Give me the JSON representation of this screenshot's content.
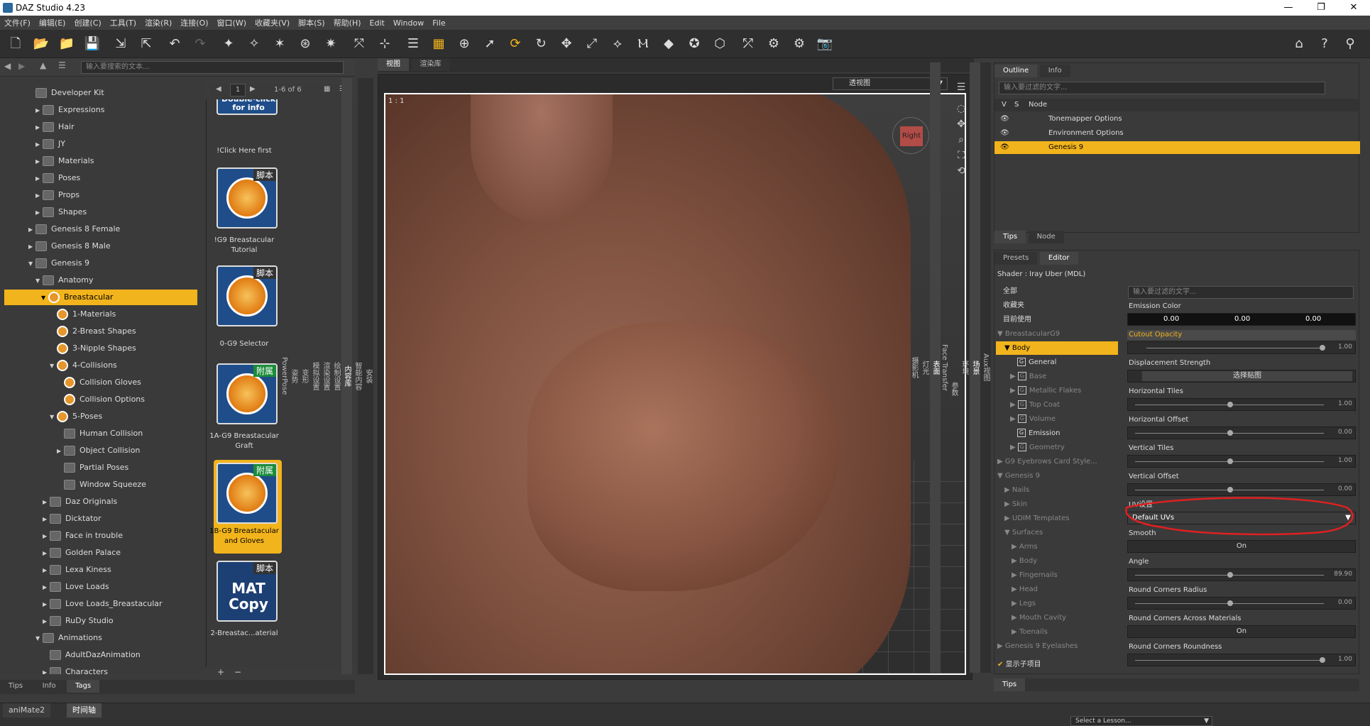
{
  "window": {
    "title": "DAZ Studio 4.23"
  },
  "menu": [
    "文件(F)",
    "编辑(E)",
    "创建(C)",
    "工具(T)",
    "渲染(R)",
    "连接(O)",
    "窗口(W)",
    "收藏夹(V)",
    "脚本(S)",
    "帮助(H)",
    "Edit",
    "Window",
    "File"
  ],
  "library": {
    "search_placeholder": "输入要搜索的文本...",
    "items": [
      {
        "label": "Developer Kit"
      },
      {
        "label": "Expressions"
      },
      {
        "label": "Hair"
      },
      {
        "label": "JY"
      },
      {
        "label": "Materials"
      },
      {
        "label": "Poses"
      },
      {
        "label": "Props"
      },
      {
        "label": "Shapes"
      },
      {
        "label": "Genesis 8 Female"
      },
      {
        "label": "Genesis 8 Male"
      },
      {
        "label": "Genesis 9"
      },
      {
        "label": "Anatomy"
      },
      {
        "label": "Breastacular"
      },
      {
        "label": "1-Materials"
      },
      {
        "label": "2-Breast Shapes"
      },
      {
        "label": "3-Nipple Shapes"
      },
      {
        "label": "4-Collisions"
      },
      {
        "label": "Collision Gloves"
      },
      {
        "label": "Collision Options"
      },
      {
        "label": "5-Poses"
      },
      {
        "label": "Human Collision"
      },
      {
        "label": "Object Collision"
      },
      {
        "label": "Partial Poses"
      },
      {
        "label": "Window Squeeze"
      },
      {
        "label": "Daz Originals"
      },
      {
        "label": "Dicktator"
      },
      {
        "label": "Face in trouble"
      },
      {
        "label": "Golden Palace"
      },
      {
        "label": "Lexa Kiness"
      },
      {
        "label": "Love Loads"
      },
      {
        "label": "Love Loads_Breastacular"
      },
      {
        "label": "RuDy Studio"
      },
      {
        "label": "Animations"
      },
      {
        "label": "AdultDazAnimation"
      },
      {
        "label": "Characters"
      }
    ],
    "bottom_tabs": [
      "Tips",
      "Info",
      "Tags"
    ]
  },
  "thumbs": {
    "page": "1",
    "count": "1-6 of 6",
    "items": [
      {
        "caption": "!Click Here first",
        "badge": "",
        "top_text": "Double-click for info"
      },
      {
        "caption": "!G9 Breastacular Tutorial",
        "badge": "脚本"
      },
      {
        "caption": "0-G9 Selector",
        "badge": "脚本"
      },
      {
        "caption": "1A-G9 Breastacular Graft",
        "badge": "附属"
      },
      {
        "caption": "1B-G9 Breastacular and Gloves",
        "badge": "附属"
      },
      {
        "caption": "2-Breastac...aterial",
        "badge": "脚本",
        "mat": "MAT Copy"
      }
    ]
  },
  "side_tabs_left": [
    "安装",
    "智能内容",
    "内容库",
    "绘制设置",
    "渲染设置",
    "模拟设置",
    "变形",
    "姿势",
    "PowerPose"
  ],
  "viewport": {
    "tabs": [
      "视图",
      "渲染库"
    ],
    "camera": "透视图",
    "ratio": "1 : 1",
    "cube_label": "Right"
  },
  "outline": {
    "tabs": [
      "Outline",
      "Info"
    ],
    "filter_placeholder": "输入要过滤的文字...",
    "cols": [
      "V",
      "S",
      "Node"
    ],
    "rows": [
      "Tonemapper Options",
      "Environment Options",
      "Genesis 9"
    ],
    "bottom_tabs": [
      "Tips",
      "Node"
    ]
  },
  "side_tabs_right": [
    "Aux视图",
    "场景",
    "环境",
    "参数",
    "Face Transfer",
    "表面",
    "灯光",
    "摄影机"
  ],
  "editor": {
    "tabs": [
      "Presets",
      "Editor"
    ],
    "shader": "Shader : Iray Uber (MDL)",
    "filter_placeholder": "输入要过滤的文字...",
    "list": [
      "全部",
      "收藏夹",
      "目前使用",
      "BreastacularG9",
      "Body",
      "General",
      "Base",
      "Metallic Flakes",
      "Top Coat",
      "Volume",
      "Emission",
      "Geometry",
      "G9 Eyebrows Card Style...",
      "Genesis 9",
      "Nails",
      "Skin",
      "UDIM Templates",
      "Surfaces",
      "Arms",
      "Body",
      "Fingernails",
      "Head",
      "Legs",
      "Mouth Cavity",
      "Toenails",
      "Genesis 9 Eyelashes"
    ],
    "show_children": "显示子项目",
    "props": [
      {
        "label": "Emission Color",
        "values": [
          "0.00",
          "0.00",
          "0.00"
        ]
      },
      {
        "label": "Cutout Opacity",
        "value": "1.00"
      },
      {
        "label": "Displacement Strength",
        "button": "选择贴图"
      },
      {
        "label": "Horizontal Tiles",
        "value": "1.00"
      },
      {
        "label": "Horizontal Offset",
        "value": "0.00"
      },
      {
        "label": "Vertical Tiles",
        "value": "1.00"
      },
      {
        "label": "Vertical Offset",
        "value": "0.00"
      },
      {
        "label": "UV设置",
        "select": "Default UVs"
      },
      {
        "label": "Smooth",
        "toggle": "On"
      },
      {
        "label": "Angle",
        "value": "89.90"
      },
      {
        "label": "Round Corners Radius",
        "value": "0.00"
      },
      {
        "label": "Round Corners Across Materials",
        "toggle": "On"
      },
      {
        "label": "Round Corners Roundness",
        "value": "1.00"
      }
    ],
    "bottom_tab": "Tips"
  },
  "bottom": {
    "tabs": [
      "aniMate2",
      "时间轴"
    ],
    "lesson": "Select a Lesson..."
  },
  "colors": {
    "accent": "#f2b41c",
    "bg": "#3b3b3b",
    "highlight_stroke": "#e02020"
  }
}
